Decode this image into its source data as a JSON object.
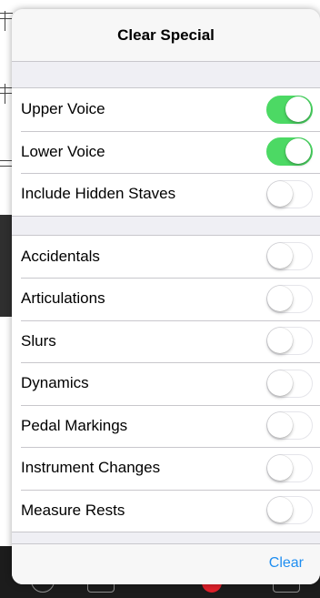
{
  "popover": {
    "title": "Clear Special",
    "group_voices": [
      {
        "label": "Upper Voice",
        "on": true
      },
      {
        "label": "Lower Voice",
        "on": true
      },
      {
        "label": "Include Hidden Staves",
        "on": false
      }
    ],
    "group_items": [
      {
        "label": "Accidentals",
        "on": false
      },
      {
        "label": "Articulations",
        "on": false
      },
      {
        "label": "Slurs",
        "on": false
      },
      {
        "label": "Dynamics",
        "on": false
      },
      {
        "label": "Pedal Markings",
        "on": false
      },
      {
        "label": "Instrument Changes",
        "on": false
      },
      {
        "label": "Measure Rests",
        "on": false
      }
    ],
    "clear_label": "Clear"
  },
  "colors": {
    "switch_on": "#4cd964",
    "link_blue": "#1f8ef1",
    "record_red": "#e0202a"
  },
  "icons": {
    "toolbar": [
      "info-icon",
      "rewind-icon",
      "play-icon",
      "record-icon",
      "metronome-icon"
    ]
  }
}
